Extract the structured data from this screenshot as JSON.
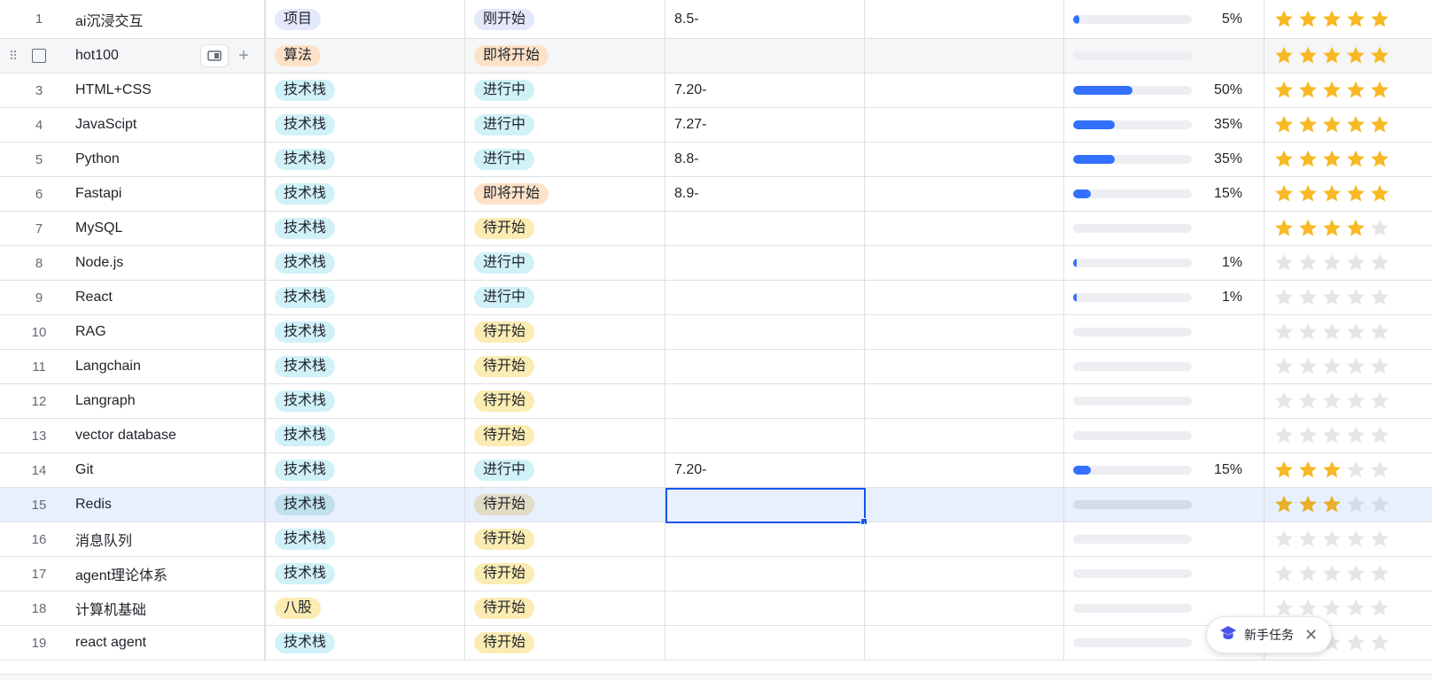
{
  "rows": [
    {
      "num": "1",
      "name": "ai沉浸交互",
      "type": "项目",
      "type_style": "proj",
      "status": "刚开始",
      "status_style": "just",
      "date": "8.5-",
      "progress": 5,
      "progress_label": "5%",
      "stars": 5
    },
    {
      "num": "",
      "name": "hot100",
      "type": "算法",
      "type_style": "algo",
      "status": "即将开始",
      "status_style": "soon",
      "date": "",
      "progress": 0,
      "progress_label": "",
      "stars": 5
    },
    {
      "num": "3",
      "name": "HTML+CSS",
      "type": "技术栈",
      "type_style": "tech",
      "status": "进行中",
      "status_style": "going",
      "date": "7.20-",
      "progress": 50,
      "progress_label": "50%",
      "stars": 5
    },
    {
      "num": "4",
      "name": "JavaScipt",
      "type": "技术栈",
      "type_style": "tech",
      "status": "进行中",
      "status_style": "going",
      "date": "7.27-",
      "progress": 35,
      "progress_label": "35%",
      "stars": 5
    },
    {
      "num": "5",
      "name": "Python",
      "type": "技术栈",
      "type_style": "tech",
      "status": "进行中",
      "status_style": "going",
      "date": "8.8-",
      "progress": 35,
      "progress_label": "35%",
      "stars": 5
    },
    {
      "num": "6",
      "name": "Fastapi",
      "type": "技术栈",
      "type_style": "tech",
      "status": "即将开始",
      "status_style": "soon",
      "date": "8.9-",
      "progress": 15,
      "progress_label": "15%",
      "stars": 5
    },
    {
      "num": "7",
      "name": "MySQL",
      "type": "技术栈",
      "type_style": "tech",
      "status": "待开始",
      "status_style": "wait",
      "date": "",
      "progress": 0,
      "progress_label": "",
      "stars": 4
    },
    {
      "num": "8",
      "name": "Node.js",
      "type": "技术栈",
      "type_style": "tech",
      "status": "进行中",
      "status_style": "going",
      "date": "",
      "progress": 1,
      "progress_label": "1%",
      "stars": 0
    },
    {
      "num": "9",
      "name": "React",
      "type": "技术栈",
      "type_style": "tech",
      "status": "进行中",
      "status_style": "going",
      "date": "",
      "progress": 1,
      "progress_label": "1%",
      "stars": 0
    },
    {
      "num": "10",
      "name": "RAG",
      "type": "技术栈",
      "type_style": "tech",
      "status": "待开始",
      "status_style": "wait",
      "date": "",
      "progress": 0,
      "progress_label": "",
      "stars": 0
    },
    {
      "num": "11",
      "name": "Langchain",
      "type": "技术栈",
      "type_style": "tech",
      "status": "待开始",
      "status_style": "wait",
      "date": "",
      "progress": 0,
      "progress_label": "",
      "stars": 0
    },
    {
      "num": "12",
      "name": "Langraph",
      "type": "技术栈",
      "type_style": "tech",
      "status": "待开始",
      "status_style": "wait",
      "date": "",
      "progress": 0,
      "progress_label": "",
      "stars": 0
    },
    {
      "num": "13",
      "name": "vector database",
      "type": "技术栈",
      "type_style": "tech",
      "status": "待开始",
      "status_style": "wait",
      "date": "",
      "progress": 0,
      "progress_label": "",
      "stars": 0
    },
    {
      "num": "14",
      "name": "Git",
      "type": "技术栈",
      "type_style": "tech",
      "status": "进行中",
      "status_style": "going",
      "date": "7.20-",
      "progress": 15,
      "progress_label": "15%",
      "stars": 3
    },
    {
      "num": "15",
      "name": "Redis",
      "type": "技术栈",
      "type_style": "tech",
      "status": "待开始",
      "status_style": "wait",
      "date": "",
      "progress": 0,
      "progress_label": "",
      "stars": 3
    },
    {
      "num": "16",
      "name": "消息队列",
      "type": "技术栈",
      "type_style": "tech",
      "status": "待开始",
      "status_style": "wait",
      "date": "",
      "progress": 0,
      "progress_label": "",
      "stars": 0
    },
    {
      "num": "17",
      "name": "agent理论体系",
      "type": "技术栈",
      "type_style": "tech",
      "status": "待开始",
      "status_style": "wait",
      "date": "",
      "progress": 0,
      "progress_label": "",
      "stars": 0
    },
    {
      "num": "18",
      "name": "计算机基础",
      "type": "八股",
      "type_style": "bagu",
      "status": "待开始",
      "status_style": "wait",
      "date": "",
      "progress": 0,
      "progress_label": "",
      "stars": 0
    },
    {
      "num": "19",
      "name": "react agent",
      "type": "技术栈",
      "type_style": "tech",
      "status": "待开始",
      "status_style": "wait",
      "date": "",
      "progress": 0,
      "progress_label": "",
      "stars": 0
    }
  ],
  "hover_row_index": 1,
  "selected_row_index": 14,
  "colors": {
    "accent": "#3370ff",
    "star_on": "#f8b924",
    "selection_border": "#1456f0"
  },
  "icons": {
    "drag_handle": "drag-handle-icon",
    "expand": "expand-record-icon",
    "add": "plus-icon",
    "star": "star-icon",
    "toast": "graduation-cap-icon",
    "close": "close-icon"
  },
  "toast": {
    "text": "新手任务"
  }
}
